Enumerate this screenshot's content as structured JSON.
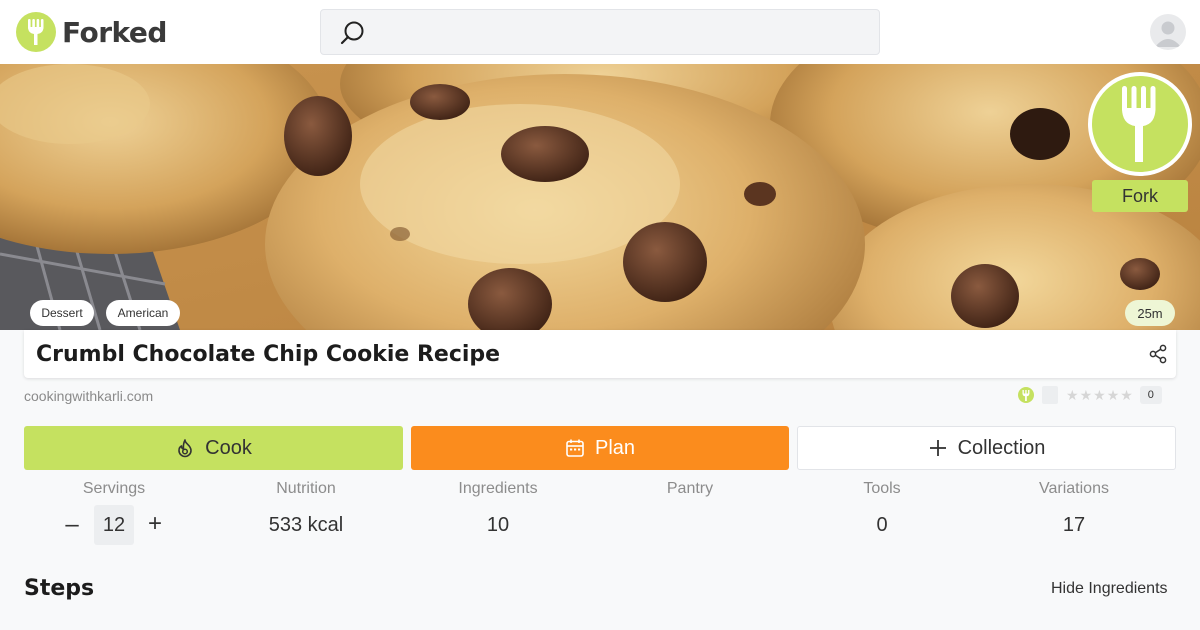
{
  "app": {
    "name": "Forked"
  },
  "search": {
    "placeholder": ""
  },
  "icons": {
    "logo": "fork-icon",
    "search": "search-icon",
    "avatar": "user-icon",
    "share": "share-icon",
    "cook": "flame-icon",
    "plan": "calendar-icon",
    "collection": "plus-icon"
  },
  "colors": {
    "brand_green": "#c5e160",
    "plan_orange": "#fb8c1d"
  },
  "hero": {
    "fork_label": "Fork",
    "tags": [
      "Dessert",
      "American"
    ],
    "time": "25m"
  },
  "recipe": {
    "title": "Crumbl Chocolate Chip Cookie Recipe",
    "source": "cookingwithkarli.com",
    "rating_stars": 0,
    "rating_max": 5,
    "rating_count": "0"
  },
  "actions": {
    "cook": "Cook",
    "plan": "Plan",
    "collection": "Collection"
  },
  "stats": {
    "servings": {
      "label": "Servings",
      "value": "12",
      "minus": "–",
      "plus": "+"
    },
    "nutrition": {
      "label": "Nutrition",
      "value": "533 kcal"
    },
    "ingredients": {
      "label": "Ingredients",
      "value": "10"
    },
    "pantry": {
      "label": "Pantry",
      "value": ""
    },
    "tools": {
      "label": "Tools",
      "value": "0"
    },
    "variations": {
      "label": "Variations",
      "value": "17"
    }
  },
  "steps": {
    "heading": "Steps",
    "toggle": "Hide Ingredients"
  }
}
